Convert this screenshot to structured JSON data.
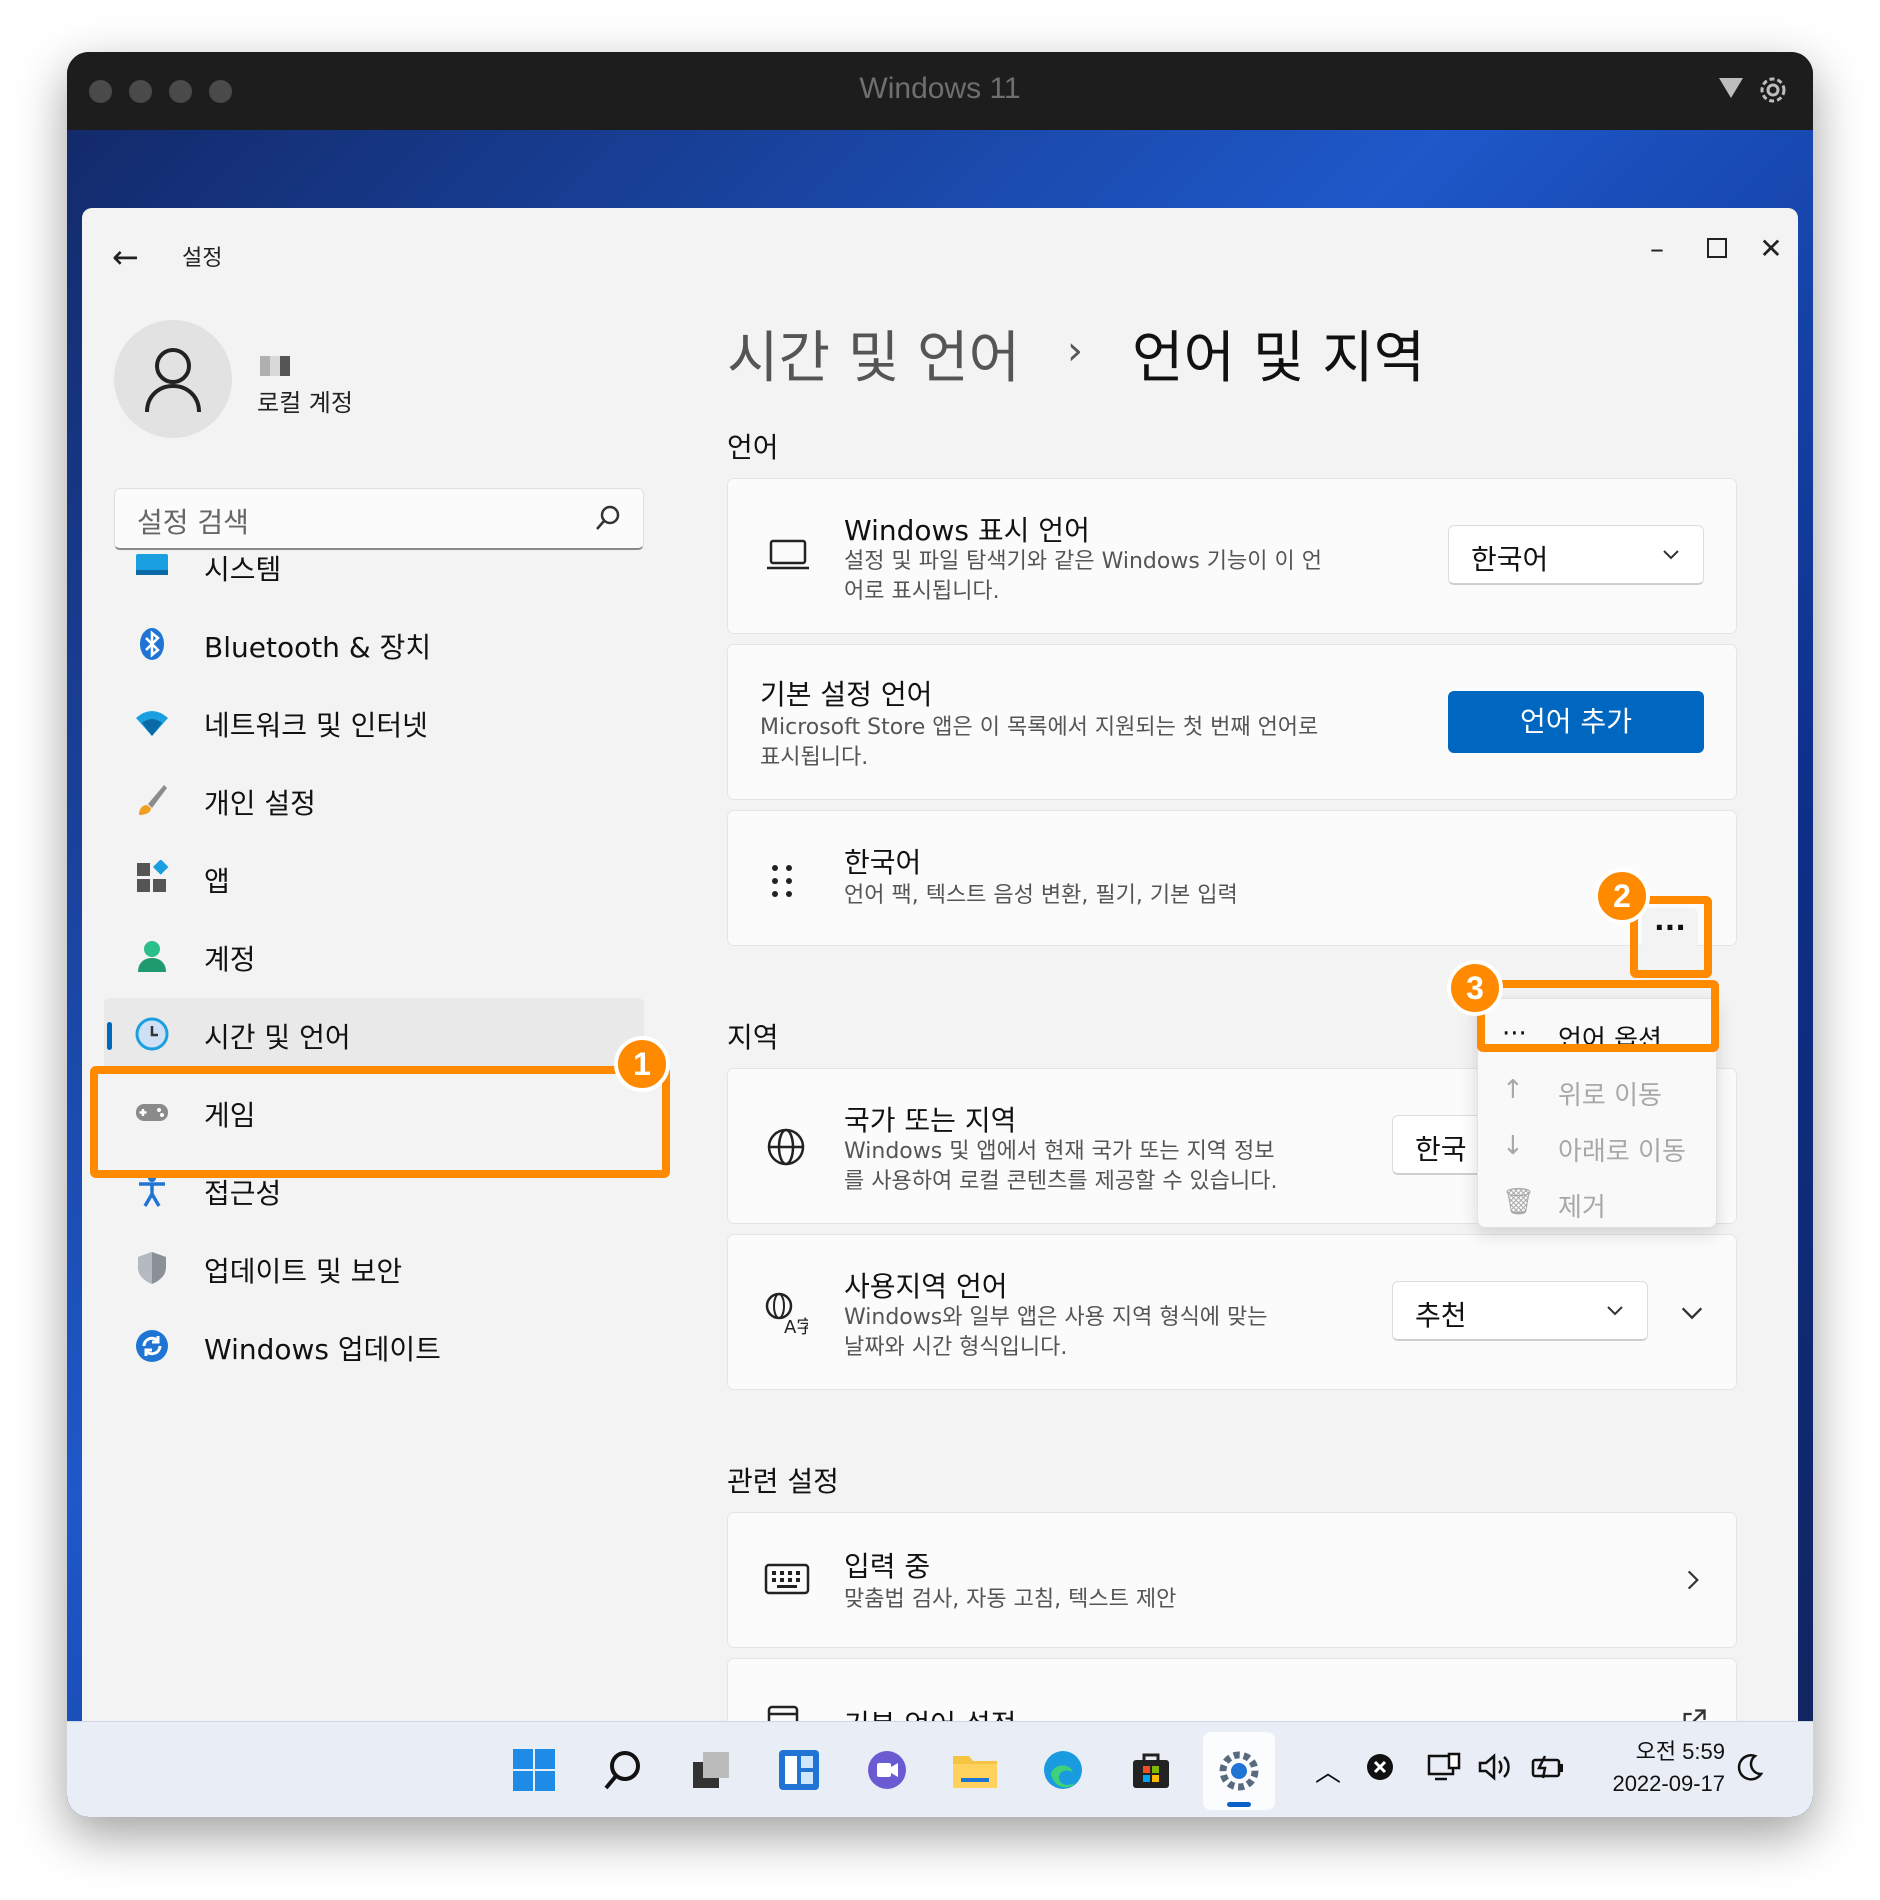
{
  "vm": {
    "title": "Windows 11"
  },
  "settings": {
    "app_title": "설정",
    "account": "로컬 계정",
    "search_placeholder": "설정 검색",
    "nav": [
      {
        "label": "시스템",
        "icon": "system-icon"
      },
      {
        "label": "Bluetooth & 장치",
        "icon": "bluetooth-icon"
      },
      {
        "label": "네트워크 및 인터넷",
        "icon": "wifi-icon"
      },
      {
        "label": "개인 설정",
        "icon": "brush-icon"
      },
      {
        "label": "앱",
        "icon": "apps-icon"
      },
      {
        "label": "계정",
        "icon": "account-icon"
      },
      {
        "label": "시간 및 언어",
        "icon": "time-language-icon",
        "selected": true
      },
      {
        "label": "게임",
        "icon": "gamepad-icon"
      },
      {
        "label": "접근성",
        "icon": "accessibility-icon"
      },
      {
        "label": "업데이트 및 보안",
        "icon": "shield-icon"
      },
      {
        "label": "Windows 업데이트",
        "icon": "windows-update-icon"
      }
    ],
    "breadcrumb": {
      "parent": "시간 및 언어",
      "separator": "›",
      "current": "언어 및 지역"
    },
    "sections": {
      "language": "언어",
      "region": "지역",
      "related": "관련 설정"
    },
    "display_language": {
      "title": "Windows 표시 언어",
      "desc1": "설정 및 파일 탐색기와 같은 Windows 기능이 이 언",
      "desc2": "어로 표시됩니다.",
      "value": "한국어"
    },
    "preferred": {
      "title": "기본 설정 언어",
      "desc1": "Microsoft Store 앱은 이 목록에서 지원되는 첫 번째 언어로",
      "desc2": "표시됩니다.",
      "button": "언어 추가"
    },
    "korean": {
      "title": "한국어",
      "desc": "언어 팩, 텍스트 음성 변환, 필기, 기본 입력",
      "more": "···"
    },
    "context_menu": [
      {
        "label": "언어 옵션",
        "icon": "···",
        "disabled": false
      },
      {
        "label": "위로 이동",
        "icon": "↑",
        "disabled": true
      },
      {
        "label": "아래로 이동",
        "icon": "↓",
        "disabled": true
      },
      {
        "label": "제거",
        "icon": "🗑",
        "disabled": true
      }
    ],
    "country": {
      "title": "국가 또는 지역",
      "desc1": "Windows 및 앱에서 현재 국가 또는 지역 정보",
      "desc2": "를 사용하여 로컬 콘텐츠를 제공할 수 있습니다.",
      "value": "한국"
    },
    "regional_format": {
      "title": "사용지역 언어",
      "desc1": "Windows와 일부 앱은 사용 지역 형식에 맞는",
      "desc2": "날짜와 시간 형식입니다.",
      "value": "추천"
    },
    "typing": {
      "title": "입력 중",
      "desc": "맞춤법 검사, 자동 고침, 텍스트 제안"
    },
    "admin_language": {
      "title": "기본 언어 설정"
    }
  },
  "annotations": {
    "badge1": "1",
    "badge2": "2",
    "badge3": "3",
    "color": "#ff8a00"
  },
  "taskbar": {
    "time": "오전 5:59",
    "date": "2022-09-17"
  }
}
